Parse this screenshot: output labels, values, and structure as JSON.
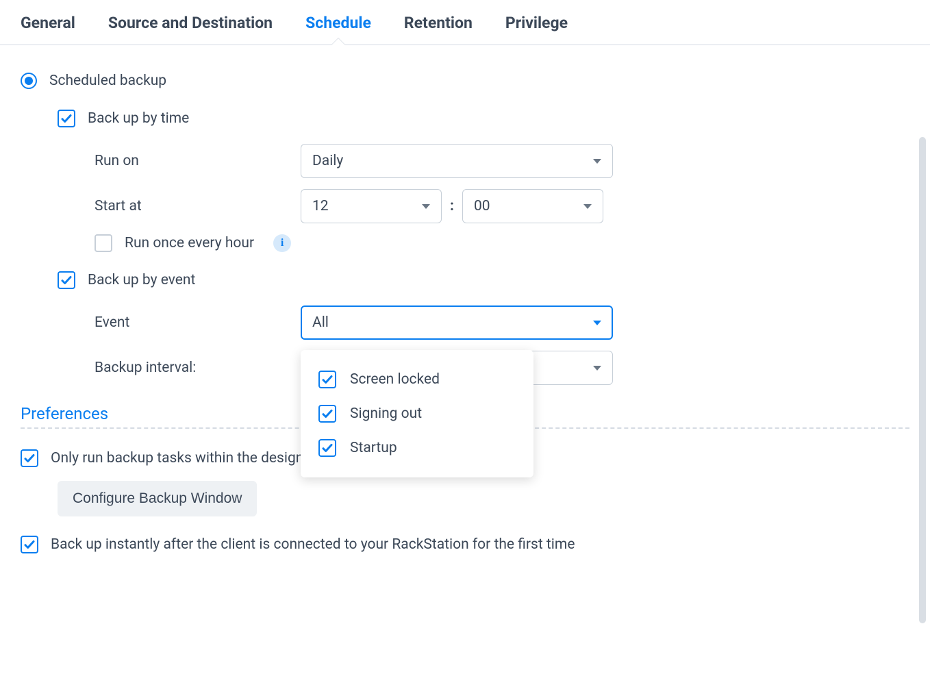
{
  "tabs": {
    "general": "General",
    "source_dest": "Source and Destination",
    "schedule": "Schedule",
    "retention": "Retention",
    "privilege": "Privilege"
  },
  "schedule": {
    "scheduled_backup": "Scheduled backup",
    "by_time": {
      "label": "Back up by time",
      "run_on_label": "Run on",
      "run_on_value": "Daily",
      "start_at_label": "Start at",
      "hour": "12",
      "minute": "00",
      "every_hour": "Run once every hour"
    },
    "by_event": {
      "label": "Back up by event",
      "event_label": "Event",
      "event_value": "All",
      "interval_label": "Backup interval:",
      "options": {
        "screen_locked": "Screen locked",
        "signing_out": "Signing out",
        "startup": "Startup"
      }
    }
  },
  "preferences": {
    "header": "Preferences",
    "only_windows": "Only run backup tasks within the designated time windows",
    "configure_button": "Configure Backup Window",
    "instant_backup": "Back up instantly after the client is connected to your RackStation for the first time"
  },
  "icons": {
    "info": "i",
    "time_sep": ":"
  }
}
